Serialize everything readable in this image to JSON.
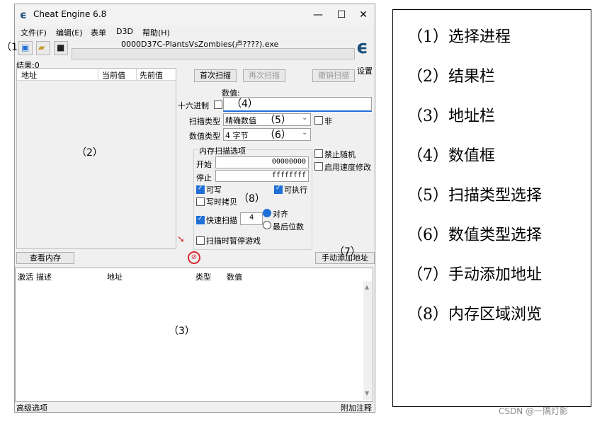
{
  "window": {
    "title": "Cheat Engine 6.8",
    "minimize": "—",
    "maximize": "☐",
    "close": "✕"
  },
  "menu": [
    "文件(F)",
    "编辑(E)",
    "表单",
    "D3D",
    "帮助(H)"
  ],
  "process_title": "0000D37C-PlantsVsZombies(卢????).exe",
  "settings_label": "设置",
  "results_label": "结果:0",
  "result_columns": [
    "地址",
    "当前值",
    "先前值"
  ],
  "scan_buttons": {
    "first": "首次扫描",
    "next": "再次扫描",
    "undo": "撤销扫描"
  },
  "value_label": "数值:",
  "hex_label": "十六进制",
  "scan_type": {
    "label": "扫描类型",
    "value": "精确数值"
  },
  "not_label": "非",
  "value_type": {
    "label": "数值类型",
    "value": "4 字节"
  },
  "mem_scan": {
    "group": "内存扫描选项",
    "start_label": "开始",
    "start_value": "00000000",
    "stop_label": "停止",
    "stop_value": "ffffffff",
    "writable": "可写",
    "executable": "可执行",
    "copy_on_write": "写时拷贝",
    "fast_scan": "快速扫描",
    "fast_value": "4",
    "align": "对齐",
    "last_digits": "最后位数",
    "pause_game": "扫描时暂停游戏"
  },
  "side_options": {
    "disable_random": "禁止随机",
    "speedhack": "启用速度修改"
  },
  "view_memory": "查看内存",
  "add_address": "手动添加地址",
  "address_columns": {
    "active": "激活",
    "desc": "描述",
    "addr": "地址",
    "type": "类型",
    "value": "数值"
  },
  "bottom": {
    "left": "高级选项",
    "right": "附加注释"
  },
  "annotations": {
    "a1": "（1",
    "a2": "（2）",
    "a3": "（3）",
    "a4": "（4）",
    "a5": "（5）",
    "a6": "（6）",
    "a7": "（7）",
    "a8": "（8）"
  },
  "legend": [
    "（1）选择进程",
    "（2）结果栏",
    "（3）地址栏",
    "（4）数值框",
    "（5）扫描类型选择",
    "（6）数值类型选择",
    "（7）手动添加地址",
    "（8）内存区域浏览"
  ],
  "watermark": "CSDN @一隅灯影",
  "colors": {
    "accent": "#1e6fd6",
    "ce_logo": "#1a4f7a",
    "stop_red": "#d8272d"
  },
  "icons": [
    "cheat-engine-logo-icon",
    "select-process-icon",
    "open-folder-icon",
    "save-disk-icon",
    "pointer-arrow-icon",
    "stop-icon",
    "chevron-down-icon"
  ]
}
